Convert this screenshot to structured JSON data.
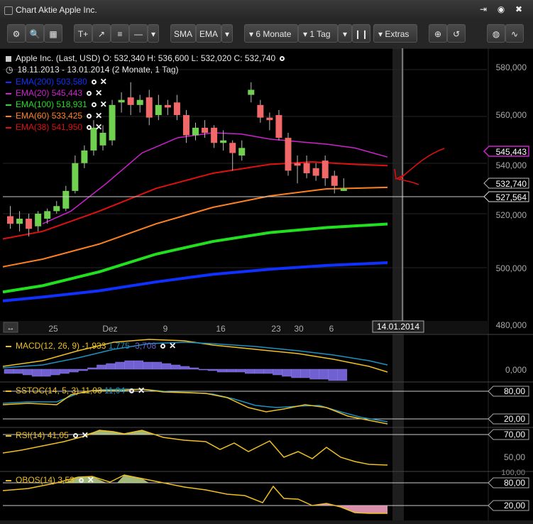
{
  "window": {
    "title": "Chart Aktie Apple Inc."
  },
  "toolbar": {
    "sma_label": "SMA",
    "ema_label": "EMA",
    "range_label": "6 Monate",
    "interval_label": "1 Tag",
    "extras_label": "Extras"
  },
  "header": {
    "quote": "Apple Inc. (Last, USD)  O: 532,340  H: 536,600  L: 532,020  C: 532,740",
    "range": "18.11.2013 - 13.01.2014 (2 Monate, 1 Tag)"
  },
  "indicators": [
    {
      "name": "EMA(200)",
      "value": "503,580",
      "color": "#1030ff"
    },
    {
      "name": "EMA(20)",
      "value": "545,443",
      "color": "#d020d0"
    },
    {
      "name": "EMA(100)",
      "value": "518,931",
      "color": "#20e020"
    },
    {
      "name": "EMA(60)",
      "value": "533,425",
      "color": "#ff8020"
    },
    {
      "name": "EMA(38)",
      "value": "541,950",
      "color": "#e01010"
    }
  ],
  "price_axis": {
    "ticks": [
      "580,000",
      "560,000",
      "540,000",
      "520,000",
      "500,000",
      "480,000"
    ],
    "flags": {
      "ema20": "545,443",
      "last": "532,740",
      "cursor": "527,564"
    }
  },
  "time_axis": {
    "labels": [
      "25",
      "Dez",
      "9",
      "16",
      "23",
      "30",
      "6"
    ],
    "cursor_date": "14.01.2014"
  },
  "subpanels": {
    "macd": {
      "label": "MACD(12, 26, 9)",
      "v1": "-1,933",
      "v2": "1,775",
      "v3": "-3,708",
      "tick": "0,000"
    },
    "sstoc": {
      "label": "SSTOC(14, 5, 3)",
      "v1": "11,03",
      "v2": "11,04",
      "upper": "80,00",
      "lower": "20,00"
    },
    "rsi": {
      "label": "RSI(14)",
      "v1": "41,05",
      "upper": "70,00",
      "mid": "50,00"
    },
    "obos": {
      "label": "OBOS(14)",
      "v1": "3,53",
      "upper": "80,00",
      "lower": "20,00",
      "top": "100,00"
    }
  },
  "chart_data": {
    "type": "candlestick",
    "ylim": [
      475,
      588
    ],
    "candles": [
      {
        "o": 522,
        "c": 519,
        "h": 526,
        "l": 517
      },
      {
        "o": 519,
        "c": 521,
        "h": 524,
        "l": 516
      },
      {
        "o": 521,
        "c": 517,
        "h": 523,
        "l": 514
      },
      {
        "o": 518,
        "c": 523,
        "h": 524,
        "l": 516
      },
      {
        "o": 521,
        "c": 524,
        "h": 525,
        "l": 519
      },
      {
        "o": 524,
        "c": 526,
        "h": 528,
        "l": 523
      },
      {
        "o": 525,
        "c": 532,
        "h": 534,
        "l": 524
      },
      {
        "o": 532,
        "c": 543,
        "h": 546,
        "l": 531
      },
      {
        "o": 543,
        "c": 548,
        "h": 550,
        "l": 541
      },
      {
        "o": 548,
        "c": 557,
        "h": 560,
        "l": 546
      },
      {
        "o": 550,
        "c": 555,
        "h": 558,
        "l": 548
      },
      {
        "o": 552,
        "c": 566,
        "h": 568,
        "l": 550
      },
      {
        "o": 567,
        "c": 568,
        "h": 571,
        "l": 563
      },
      {
        "o": 569,
        "c": 566,
        "h": 575,
        "l": 562
      },
      {
        "o": 566,
        "c": 568,
        "h": 570,
        "l": 563
      },
      {
        "o": 569,
        "c": 561,
        "h": 572,
        "l": 558
      },
      {
        "o": 562,
        "c": 566,
        "h": 570,
        "l": 560
      },
      {
        "o": 566,
        "c": 565,
        "h": 568,
        "l": 562
      },
      {
        "o": 567,
        "c": 562,
        "h": 570,
        "l": 560
      },
      {
        "o": 562,
        "c": 554,
        "h": 564,
        "l": 551
      },
      {
        "o": 554,
        "c": 557,
        "h": 559,
        "l": 552
      },
      {
        "o": 557,
        "c": 555,
        "h": 560,
        "l": 553
      },
      {
        "o": 557,
        "c": 551,
        "h": 558,
        "l": 549
      },
      {
        "o": 551,
        "c": 552,
        "h": 556,
        "l": 548
      },
      {
        "o": 551,
        "c": 547,
        "h": 552,
        "l": 540
      },
      {
        "o": 546,
        "c": 549,
        "h": 552,
        "l": 544
      },
      {
        "o": 570,
        "c": 572,
        "h": 575,
        "l": 567
      },
      {
        "o": 566,
        "c": 561,
        "h": 568,
        "l": 559
      },
      {
        "o": 561,
        "c": 560,
        "h": 563,
        "l": 556
      },
      {
        "o": 562,
        "c": 553,
        "h": 564,
        "l": 552
      },
      {
        "o": 553,
        "c": 540,
        "h": 555,
        "l": 538
      },
      {
        "o": 543,
        "c": 542,
        "h": 546,
        "l": 535
      },
      {
        "o": 543,
        "c": 539,
        "h": 546,
        "l": 537
      },
      {
        "o": 541,
        "c": 538,
        "h": 543,
        "l": 536
      },
      {
        "o": 544,
        "c": 537,
        "h": 546,
        "l": 534
      },
      {
        "o": 538,
        "c": 534,
        "h": 540,
        "l": 531
      },
      {
        "o": 532,
        "c": 533,
        "h": 537,
        "l": 532
      }
    ]
  }
}
